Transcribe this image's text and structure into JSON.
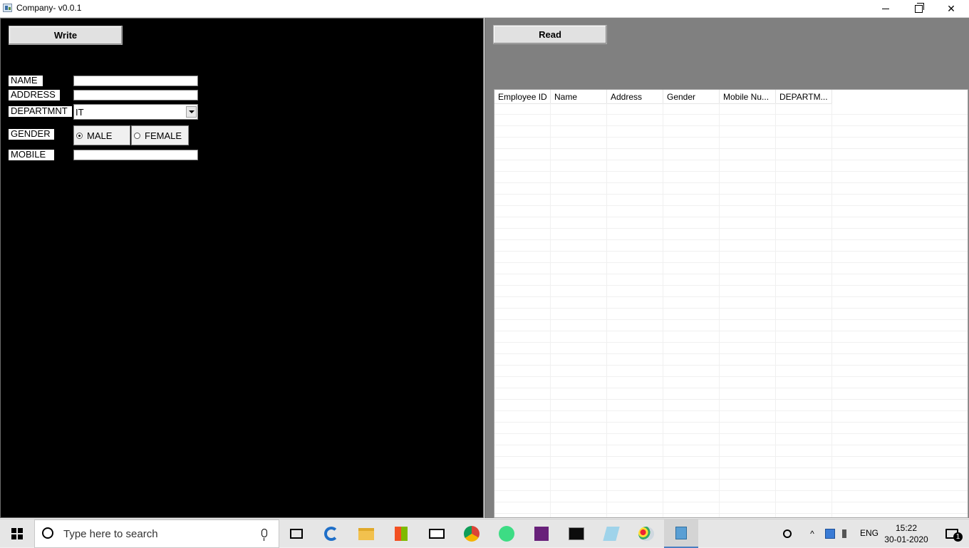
{
  "window": {
    "title": "Company- v0.0.1"
  },
  "left": {
    "write_button": "Write",
    "labels": {
      "name": "NAME",
      "address": "ADDRESS",
      "department": "DEPARTMNT",
      "gender": "GENDER",
      "mobile": "MOBILE"
    },
    "fields": {
      "name": "",
      "address": "",
      "department": "IT",
      "mobile": ""
    },
    "gender_options": [
      {
        "label": "MALE",
        "checked": true
      },
      {
        "label": "FEMALE",
        "checked": false
      }
    ]
  },
  "right": {
    "read_button": "Read",
    "columns": [
      "Employee ID",
      "Name",
      "Address",
      "Gender",
      "Mobile Nu...",
      "DEPARTM..."
    ],
    "rows": []
  },
  "taskbar": {
    "search_placeholder": "Type here to search",
    "apps": [
      "task-view-icon",
      "edge-icon",
      "file-explorer-icon",
      "store-icon",
      "mail-icon",
      "chrome-icon",
      "android-studio-icon",
      "visual-studio-icon",
      "terminal-icon",
      "notepad-icon",
      "paint-icon",
      "company-app-icon"
    ],
    "language": "ENG",
    "time": "15:22",
    "date": "30-01-2020",
    "notification_count": "1"
  },
  "colors": {
    "left_panel_bg": "#000000",
    "right_panel_bg": "#808080",
    "accent": "#4a7fc1"
  }
}
